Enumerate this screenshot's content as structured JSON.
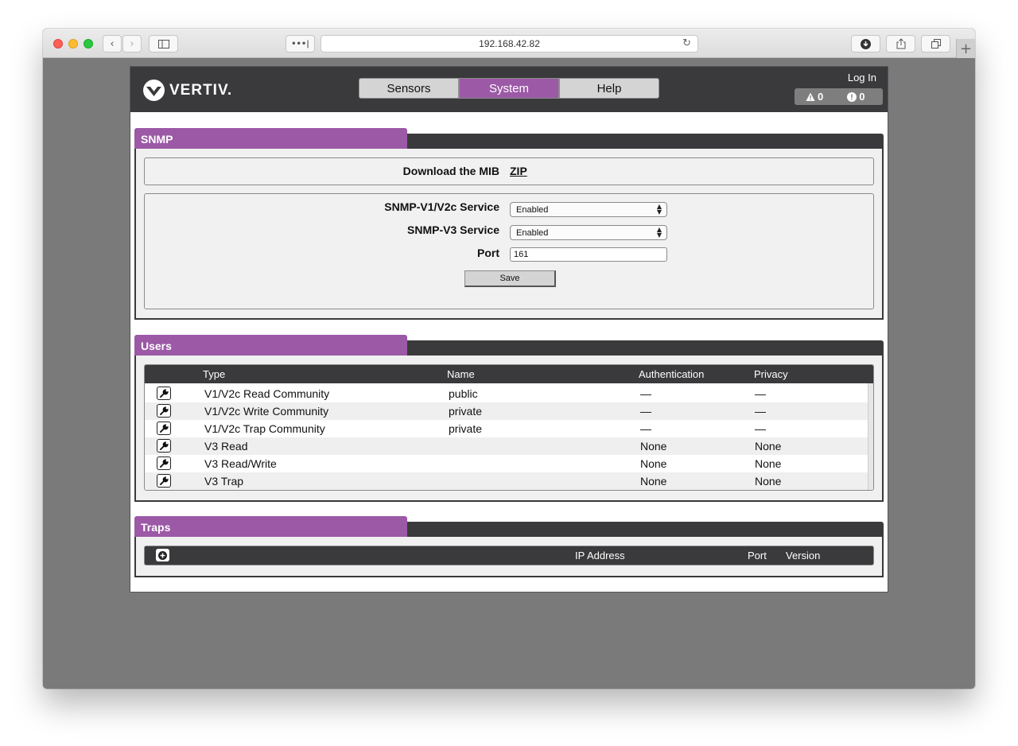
{
  "browser": {
    "url": "192.168.42.82"
  },
  "header": {
    "brand": "VERTIV.",
    "nav": [
      "Sensors",
      "System",
      "Help"
    ],
    "active_tab": "System",
    "login_label": "Log In",
    "warning_count": "0",
    "alarm_count": "0"
  },
  "colors": {
    "accent": "#9b59a6",
    "header_bg": "#3a3a3c",
    "window_bg": "#7a7a7a"
  },
  "snmp": {
    "title": "SNMP",
    "download_label": "Download the MIB",
    "download_link": "ZIP",
    "v1v2c_label": "SNMP-V1/V2c Service",
    "v1v2c_value": "Enabled",
    "v3_label": "SNMP-V3 Service",
    "v3_value": "Enabled",
    "port_label": "Port",
    "port_value": "161",
    "save_label": "Save"
  },
  "users": {
    "title": "Users",
    "columns": [
      "Type",
      "Name",
      "Authentication",
      "Privacy"
    ],
    "rows": [
      {
        "type": "V1/V2c Read Community",
        "name": "public",
        "auth": "—",
        "privacy": "—"
      },
      {
        "type": "V1/V2c Write Community",
        "name": "private",
        "auth": "—",
        "privacy": "—"
      },
      {
        "type": "V1/V2c Trap Community",
        "name": "private",
        "auth": "—",
        "privacy": "—"
      },
      {
        "type": "V3 Read",
        "name": "",
        "auth": "None",
        "privacy": "None"
      },
      {
        "type": "V3 Read/Write",
        "name": "",
        "auth": "None",
        "privacy": "None"
      },
      {
        "type": "V3 Trap",
        "name": "",
        "auth": "None",
        "privacy": "None"
      }
    ]
  },
  "traps": {
    "title": "Traps",
    "columns": [
      "IP Address",
      "Port",
      "Version"
    ]
  },
  "icons": {
    "edit": "wrench-icon",
    "add": "plus-circle-icon",
    "warning": "warning-triangle-icon",
    "alarm": "alert-circle-icon"
  }
}
